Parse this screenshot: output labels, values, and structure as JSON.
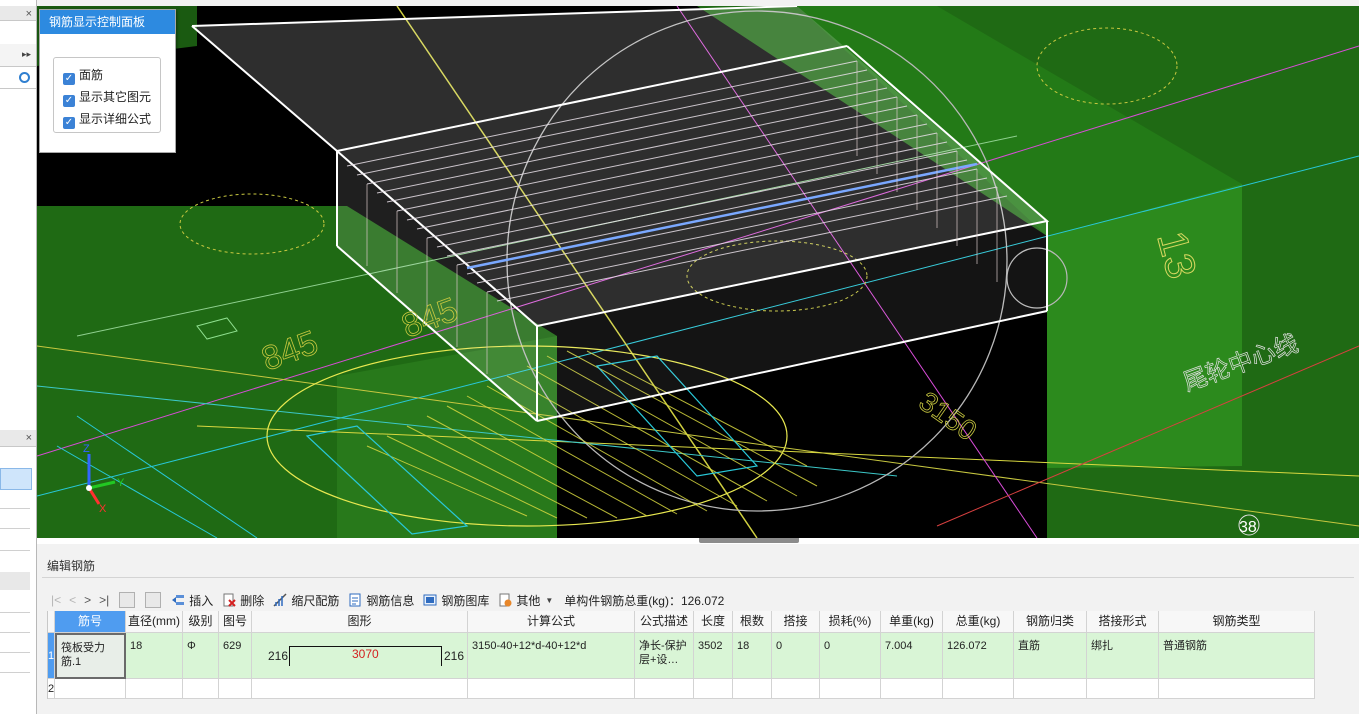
{
  "viewport": {
    "labels": {
      "dim_a": "845",
      "dim_b": "845",
      "dim_c": "3150",
      "axis_num": "13",
      "axis_text": "尾轮中心线",
      "marker": "38"
    },
    "axes": {
      "x": "X",
      "y": "Y",
      "z": "Z"
    }
  },
  "control_panel": {
    "title": "钢筋显示控制面板",
    "options": [
      {
        "label": "面筋",
        "checked": true
      },
      {
        "label": "显示其它图元",
        "checked": true
      },
      {
        "label": "显示详细公式",
        "checked": true
      }
    ]
  },
  "editor": {
    "title": "编辑钢筋",
    "toolbar": {
      "nav": [
        "|<",
        "<",
        ">",
        ">|"
      ],
      "insert": "插入",
      "delete": "删除",
      "scale_rebar": "缩尺配筋",
      "rebar_info": "钢筋信息",
      "rebar_library": "钢筋图库",
      "other": "其他",
      "total_weight_label": "单构件钢筋总重(kg)：126.072"
    },
    "columns": [
      "筋号",
      "直径(mm)",
      "级别",
      "图号",
      "图形",
      "计算公式",
      "公式描述",
      "长度",
      "根数",
      "搭接",
      "损耗(%)",
      "单重(kg)",
      "总重(kg)",
      "钢筋归类",
      "搭接形式",
      "钢筋类型"
    ],
    "rows": [
      {
        "num": "1",
        "name": "筏板受力筋.1",
        "diameter": "18",
        "grade": "Φ",
        "shape_no": "629",
        "shape_left": "216",
        "shape_mid": "3070",
        "shape_right": "216",
        "formula": "3150-40+12*d-40+12*d",
        "formula_desc": "净长-保护层+设…",
        "length": "3502",
        "count": "18",
        "lap": "0",
        "loss": "0",
        "unit_weight": "7.004",
        "total_weight": "126.072",
        "category": "直筋",
        "lap_type": "绑扎",
        "rebar_type": "普通钢筋"
      },
      {
        "num": "2"
      }
    ]
  },
  "colors": {
    "accent": "#2d8ae0",
    "row_green": "#d9f5d6",
    "viewport_bg": "#000000",
    "concrete_green": "#1f6a14"
  }
}
